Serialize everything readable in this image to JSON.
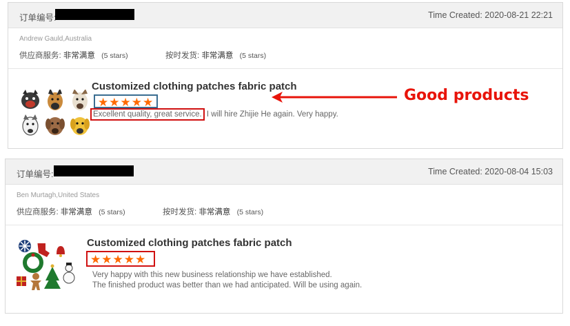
{
  "colors": {
    "star": "#ff6a00",
    "highlight": "#d01010",
    "annotation": "#e8140a",
    "header_bg": "#f1f1f1"
  },
  "annotation": {
    "text": "Good products"
  },
  "reviews": [
    {
      "order_label": "订单编号:",
      "time_created": "Time Created: 2020-08-21 22:21",
      "buyer": "Andrew Gauld,Australia",
      "supplier_service_label": "供应商服务:",
      "supplier_service_value": "非常满意",
      "supplier_service_stars": "(5 stars)",
      "shipping_label": "按时发货:",
      "shipping_value": "非常满意",
      "shipping_stars": "(5 stars)",
      "product_title": "Customized clothing patches fabric patch",
      "star_rating": 5,
      "review_part1": "Excellent quality, great service.",
      "review_part2": "I will hire Zhijie He again. Very happy.",
      "thumbnail_icons": [
        "dog-patch-icon",
        "german-shepherd-patch-icon",
        "dog-patch-icon",
        "husky-patch-icon",
        "labrador-patch-icon",
        "golden-retriever-patch-icon"
      ]
    },
    {
      "order_label": "订单编号:",
      "time_created": "Time Created: 2020-08-04 15:03",
      "buyer": "Ben Murtagh,United States",
      "supplier_service_label": "供应商服务:",
      "supplier_service_value": "非常满意",
      "supplier_service_stars": "(5 stars)",
      "shipping_label": "按时发货:",
      "shipping_value": "非常满意",
      "shipping_stars": "(5 stars)",
      "product_title": "Customized clothing patches fabric patch",
      "star_rating": 5,
      "review_line1": "Very happy with this new business relationship we have established.",
      "review_line2": "The finished product was better than we had anticipated. Will be using again.",
      "thumbnail_icons": [
        "snowflake-patch-icon",
        "stocking-patch-icon",
        "bell-patch-icon",
        "wreath-patch-icon",
        "gingerbread-patch-icon",
        "tree-patch-icon",
        "snowman-patch-icon",
        "gift-patch-icon"
      ]
    }
  ]
}
